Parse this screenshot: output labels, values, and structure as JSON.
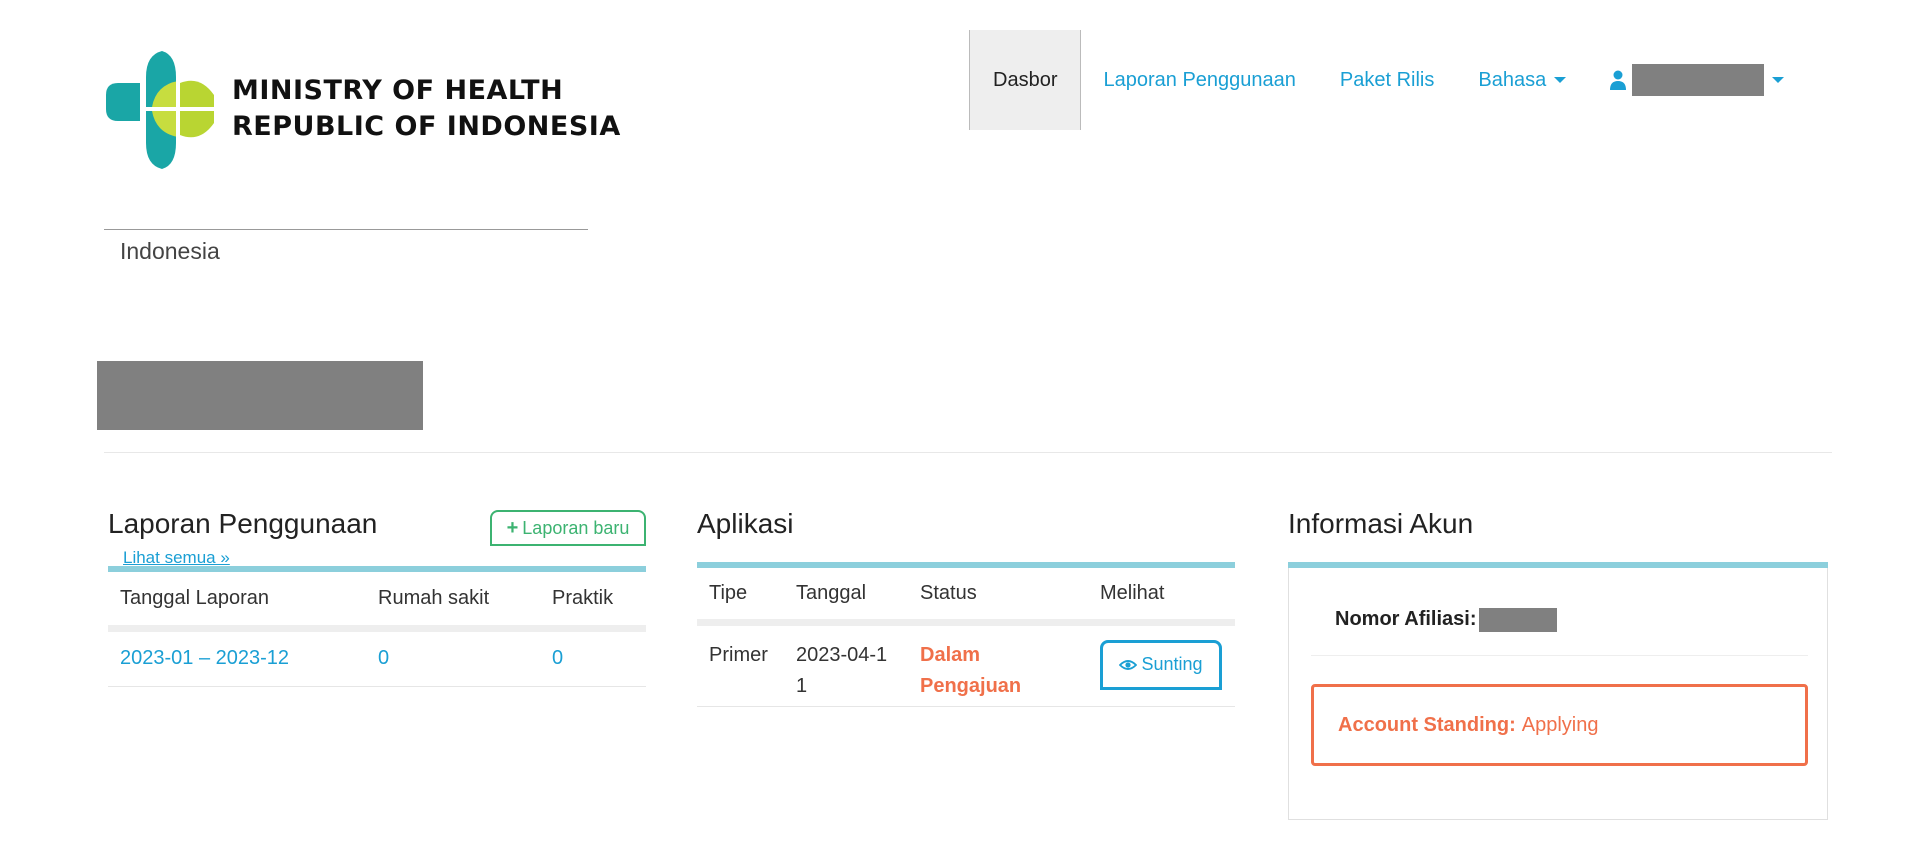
{
  "header": {
    "logo_line1": "MINISTRY OF HEALTH",
    "logo_line2": "REPUBLIC OF INDONESIA",
    "country": "Indonesia",
    "brand_colors": {
      "teal": "#1aa6a6",
      "lime": "#b9d532"
    }
  },
  "nav": {
    "items": [
      {
        "label": "Dasbor",
        "active": true
      },
      {
        "label": "Laporan Penggunaan"
      },
      {
        "label": "Paket Rilis"
      },
      {
        "label": "Bahasa"
      }
    ],
    "user_icon": "user-icon"
  },
  "usage_panel": {
    "title": "Laporan Penggunaan",
    "new_button": "Laporan baru",
    "see_all": "Lihat semua »",
    "columns": [
      "Tanggal Laporan",
      "Rumah sakit",
      "Praktik"
    ],
    "rows": [
      {
        "period": "2023-01 – 2023-12",
        "hospital": "0",
        "practice": "0"
      }
    ]
  },
  "app_panel": {
    "title": "Aplikasi",
    "columns": [
      "Tipe",
      "Tanggal",
      "Status",
      "Melihat"
    ],
    "rows": [
      {
        "type": "Primer",
        "date": "2023-04-11",
        "status": "Dalam Pengajuan",
        "action": "Sunting"
      }
    ]
  },
  "account_panel": {
    "title": "Informasi Akun",
    "affiliate_label": "Nomor Afiliasi:",
    "standing_label": "Account Standing:",
    "standing_value": "Applying"
  },
  "colors": {
    "link": "#1a9fd4",
    "accent_bar": "#8ccfdc",
    "status": "#f0704a",
    "success": "#3cb371"
  }
}
